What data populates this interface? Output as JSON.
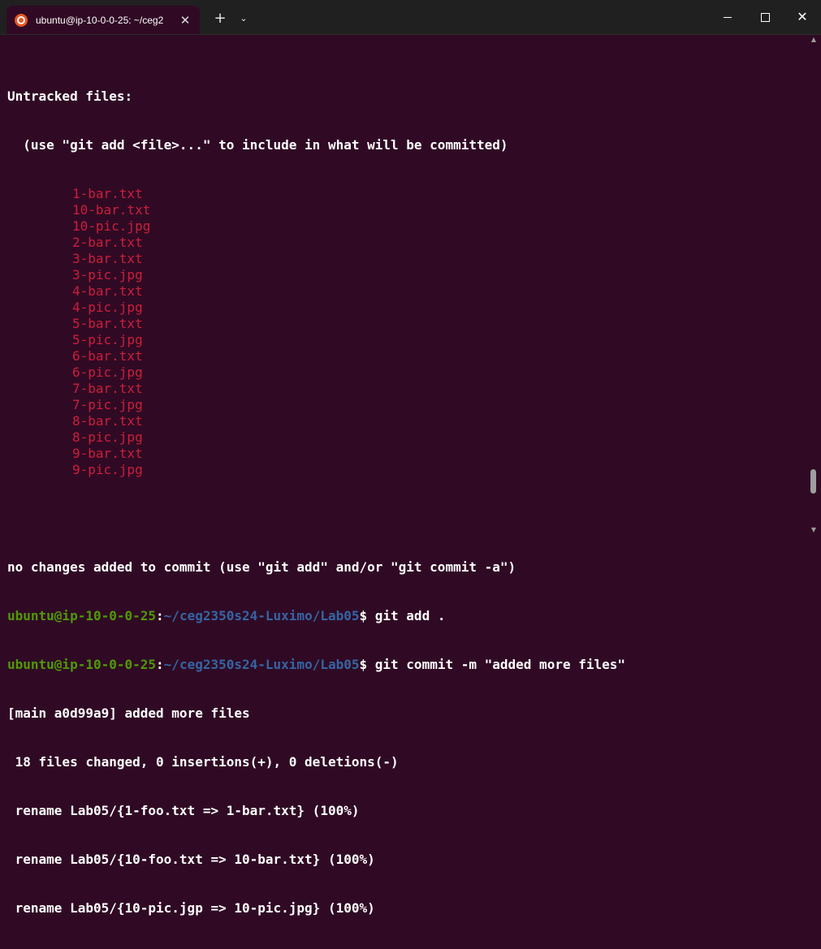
{
  "window": {
    "tab_title": "ubuntu@ip-10-0-0-25: ~/ceg2",
    "tab_close": "✕",
    "new_tab": "+",
    "dropdown": "⌄",
    "close": "✕",
    "icon": "ubuntu-logo"
  },
  "terminal": {
    "header": "Untracked files:",
    "hint": "  (use \"git add <file>...\" to include in what will be committed)",
    "untracked_files": [
      "1-bar.txt",
      "10-bar.txt",
      "10-pic.jpg",
      "2-bar.txt",
      "3-bar.txt",
      "3-pic.jpg",
      "4-bar.txt",
      "4-pic.jpg",
      "5-bar.txt",
      "5-pic.jpg",
      "6-bar.txt",
      "6-pic.jpg",
      "7-bar.txt",
      "7-pic.jpg",
      "8-bar.txt",
      "8-pic.jpg",
      "9-bar.txt",
      "9-pic.jpg"
    ],
    "no_changes": "no changes added to commit (use \"git add\" and/or \"git commit -a\")",
    "prompt_user": "ubuntu@ip-10-0-0-25",
    "prompt_sep": ":",
    "prompt_path": "~/ceg2350s24-Luximo/Lab05",
    "prompt_dollar": "$ ",
    "cmd1": "git add .",
    "cmd2": "git commit -m \"added more files\"",
    "commit_line": "[main a0d99a9] added more files",
    "stat_line": " 18 files changed, 0 insertions(+), 0 deletions(-)",
    "renames": [
      " rename Lab05/{1-foo.txt => 1-bar.txt} (100%)",
      " rename Lab05/{10-foo.txt => 10-bar.txt} (100%)",
      " rename Lab05/{10-pic.jgp => 10-pic.jpg} (100%)"
    ]
  },
  "colors": {
    "background": "#300a24",
    "untracked": "#cd1e3c",
    "prompt_user": "#4e9a06",
    "prompt_path": "#3465a4"
  }
}
